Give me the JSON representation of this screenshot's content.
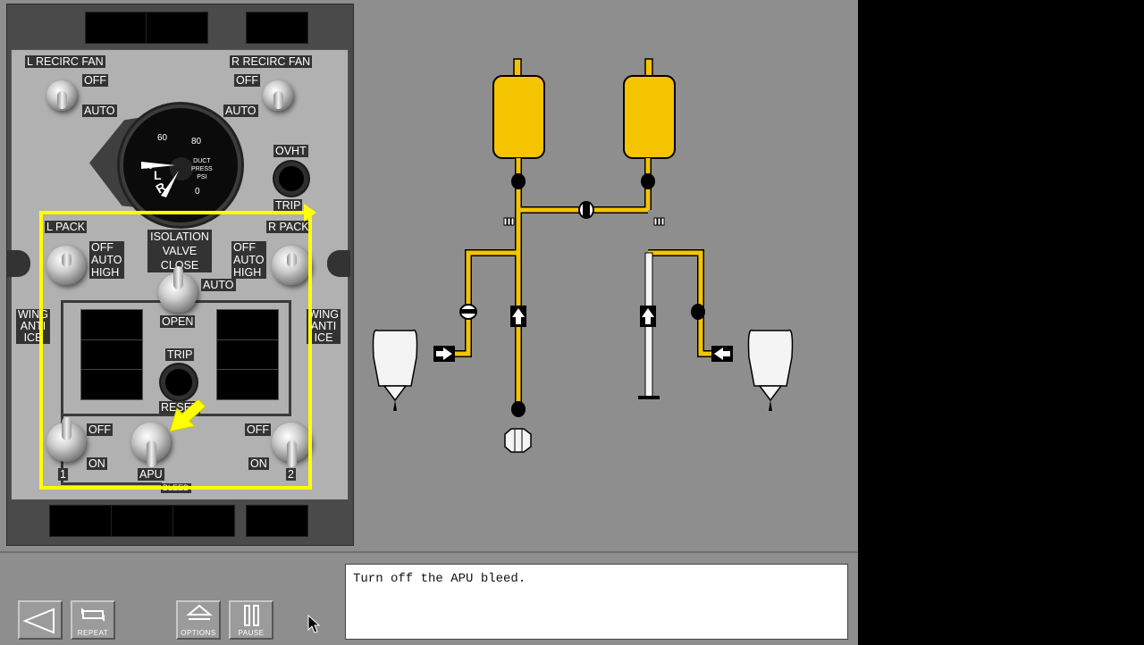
{
  "panel": {
    "l_recirc_fan": {
      "title": "L RECIRC FAN",
      "off": "OFF",
      "auto": "AUTO"
    },
    "r_recirc_fan": {
      "title": "R RECIRC FAN",
      "off": "OFF",
      "auto": "AUTO"
    },
    "gauge": {
      "ticks": [
        "40",
        "60",
        "80",
        "0"
      ],
      "caption": [
        "DUCT",
        "PRESS",
        "PSI"
      ],
      "needle_labels": [
        "L",
        "R"
      ]
    },
    "ovht": {
      "label": "OVHT",
      "trip": "TRIP"
    },
    "l_pack": {
      "title": "L PACK",
      "options": [
        "OFF",
        "AUTO",
        "HIGH"
      ]
    },
    "r_pack": {
      "title": "R PACK",
      "options": [
        "OFF",
        "AUTO",
        "HIGH"
      ]
    },
    "isolation_valve": {
      "options": [
        "ISOLATION",
        "VALVE",
        "CLOSE"
      ],
      "auto": "AUTO",
      "open": "OPEN"
    },
    "wing_anti_ice_left": [
      "WING",
      "ANTI",
      "ICE"
    ],
    "wing_anti_ice_right": [
      "WING",
      "ANTI",
      "ICE"
    ],
    "trip_reset": {
      "trip": "TRIP",
      "reset": "RESET"
    },
    "bleed_1": {
      "off": "OFF",
      "on": "ON",
      "num": "1"
    },
    "apu_bleed": {
      "label": "APU"
    },
    "bleed_2": {
      "off": "OFF",
      "on": "ON",
      "num": "2"
    },
    "bleed_plate": "BLEED"
  },
  "controls": {
    "back": {
      "label": ""
    },
    "repeat": {
      "label": "REPEAT"
    },
    "options": {
      "label": "OPTIONS"
    },
    "pause": {
      "label": "PAUSE"
    }
  },
  "message": "Turn off the APU bleed.",
  "colors": {
    "duct_active": "#f5c400",
    "highlight": "#ffff00",
    "panel": "#b1b1b1",
    "background": "#8e8e8e"
  }
}
